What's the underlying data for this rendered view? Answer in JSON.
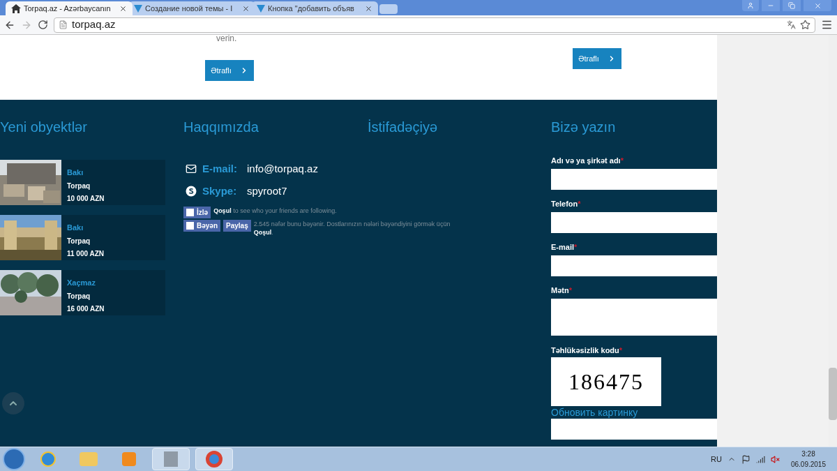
{
  "browser": {
    "tabs": [
      {
        "title": "Torpaq.az - Azərbaycanın",
        "selected": true
      },
      {
        "title": "Создание новой темы - I",
        "selected": false
      },
      {
        "title": "Кнопка \"добавить объяв",
        "selected": false
      }
    ],
    "url": "torpaq.az"
  },
  "content_top": {
    "text": "verin.",
    "buttons": [
      {
        "label": "Ətraflı"
      },
      {
        "label": "Ətraflı"
      }
    ]
  },
  "footer": {
    "new_objects": {
      "title": "Yeni obyektlər",
      "items": [
        {
          "city": "Bakı",
          "type": "Torpaq",
          "price": "10 000 AZN"
        },
        {
          "city": "Bakı",
          "type": "Torpaq",
          "price": "11 000 AZN"
        },
        {
          "city": "Xaçmaz",
          "type": "Torpaq",
          "price": "16 000 AZN"
        }
      ]
    },
    "about": {
      "title": "Haqqımızda",
      "contacts": [
        {
          "kind": "email",
          "label": "E-mail:",
          "value": "info@torpaq.az"
        },
        {
          "kind": "skype",
          "label": "Skype:",
          "value": "spyroot7"
        }
      ],
      "follow": {
        "button": "İzlə",
        "link": "Qoşul",
        "text": "to see who your friends are following."
      },
      "like": {
        "like_button": "Bəyən",
        "share_button": "Paylaş",
        "text": "2.545 nəfər bunu bəyənir. Dostlarınızın nələri bəyəndiyini görmək üçün",
        "link": "Qoşul",
        "end": "."
      }
    },
    "user": {
      "title": "İstifadəçiyə"
    },
    "contact": {
      "title": "Bizə yazın",
      "fields": [
        {
          "label": "Adı və ya şirkət adı",
          "required": "*",
          "kind": "input"
        },
        {
          "label": "Telefon",
          "required": "*",
          "kind": "input"
        },
        {
          "label": "E-mail",
          "required": "*",
          "kind": "input"
        },
        {
          "label": "Mətn",
          "required": "*",
          "kind": "textarea"
        }
      ],
      "captcha": {
        "label": "Təhlükəsizlik kodu",
        "required": "*",
        "code": "186475",
        "refresh": "Обновить картинку"
      }
    }
  },
  "taskbar": {
    "language": "RU",
    "time": "3:28",
    "date": "06.09.2015"
  }
}
